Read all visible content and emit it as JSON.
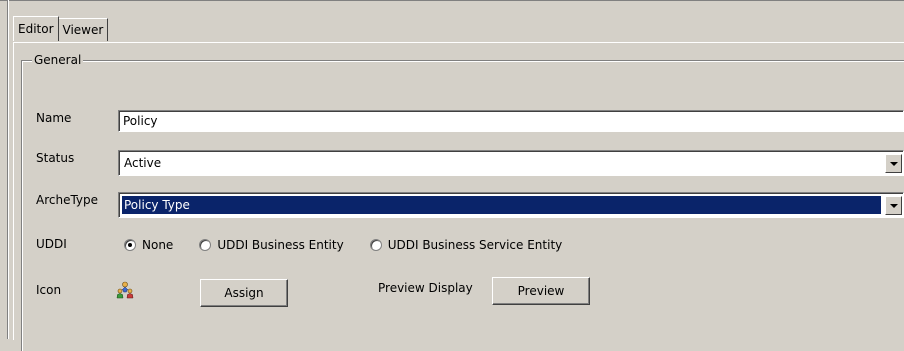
{
  "tabs": [
    {
      "label": "Editor",
      "active": true
    },
    {
      "label": "Viewer",
      "active": false
    }
  ],
  "group": {
    "title": "General"
  },
  "fields": {
    "name": {
      "label": "Name",
      "value": "Policy"
    },
    "status": {
      "label": "Status",
      "value": "Active"
    },
    "archetype": {
      "label": "ArcheType",
      "value": "Policy Type"
    },
    "uddi": {
      "label": "UDDI",
      "options": [
        {
          "label": "None",
          "selected": true
        },
        {
          "label": "UDDI Business Entity",
          "selected": false
        },
        {
          "label": "UDDI Business Service Entity",
          "selected": false
        }
      ]
    },
    "icon": {
      "label": "Icon",
      "icon": "people-group-icon"
    }
  },
  "buttons": {
    "assign": "Assign",
    "preview_label": "Preview Display",
    "preview": "Preview"
  },
  "colors": {
    "background": "#d4d0c8",
    "selection": "#0a246a"
  }
}
